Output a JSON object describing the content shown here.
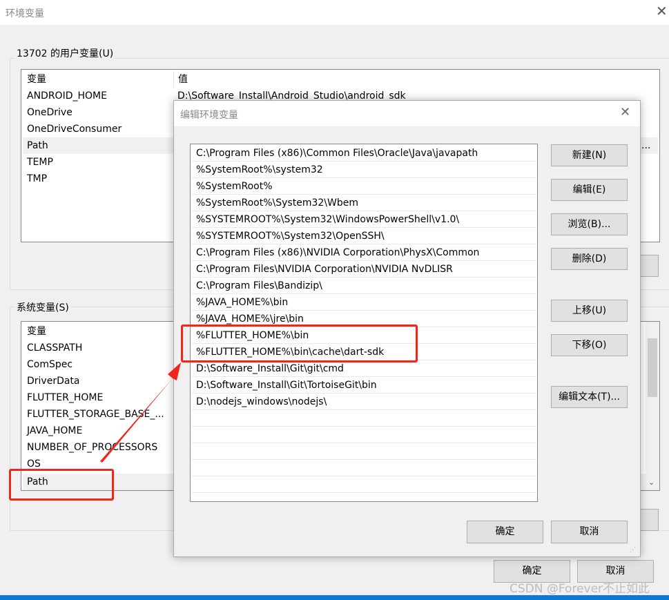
{
  "window": {
    "title": "环境变量",
    "close_icon": "close-icon"
  },
  "user_vars": {
    "label": "13702 的用户变量(U)",
    "col_name": "变量",
    "col_value": "值",
    "rows": [
      {
        "name": "ANDROID_HOME",
        "value": "D:\\Software_Install\\Android_Studio\\android_sdk"
      },
      {
        "name": "OneDrive",
        "value": ""
      },
      {
        "name": "OneDriveConsumer",
        "value": ""
      },
      {
        "name": "Path",
        "value": "..."
      },
      {
        "name": "TEMP",
        "value": ""
      },
      {
        "name": "TMP",
        "value": ""
      }
    ],
    "selected": "Path"
  },
  "system_vars": {
    "label": "系统变量(S)",
    "col_name": "变量",
    "rows": [
      "CLASSPATH",
      "ComSpec",
      "DriverData",
      "FLUTTER_HOME",
      "FLUTTER_STORAGE_BASE_...",
      "JAVA_HOME",
      "NUMBER_OF_PROCESSORS",
      "OS",
      "Path"
    ],
    "selected": "Path"
  },
  "main_buttons": {
    "ok": "确定",
    "cancel": "取消"
  },
  "dialog": {
    "title": "编辑环境变量",
    "entries": [
      "C:\\Program Files (x86)\\Common Files\\Oracle\\Java\\javapath",
      "%SystemRoot%\\system32",
      "%SystemRoot%",
      "%SystemRoot%\\System32\\Wbem",
      "%SYSTEMROOT%\\System32\\WindowsPowerShell\\v1.0\\",
      "%SYSTEMROOT%\\System32\\OpenSSH\\",
      "C:\\Program Files (x86)\\NVIDIA Corporation\\PhysX\\Common",
      "C:\\Program Files\\NVIDIA Corporation\\NVIDIA NvDLISR",
      "C:\\Program Files\\Bandizip\\",
      "%JAVA_HOME%\\bin",
      "%JAVA_HOME%\\jre\\bin",
      "%FLUTTER_HOME%\\bin",
      "%FLUTTER_HOME%\\bin\\cache\\dart-sdk",
      "D:\\Software_Install\\Git\\git\\cmd",
      "D:\\Software_Install\\Git\\TortoiseGit\\bin",
      "D:\\nodejs_windows\\nodejs\\"
    ],
    "buttons": {
      "new": "新建(N)",
      "edit": "编辑(E)",
      "browse": "浏览(B)...",
      "delete": "删除(D)",
      "move_up": "上移(U)",
      "move_down": "下移(O)",
      "edit_text": "编辑文本(T)...",
      "ok": "确定",
      "cancel": "取消"
    }
  },
  "annotation_color": "#f0261c",
  "watermark": "CSDN @Forever不止如此",
  "taskbar_color": "#0a78d4"
}
